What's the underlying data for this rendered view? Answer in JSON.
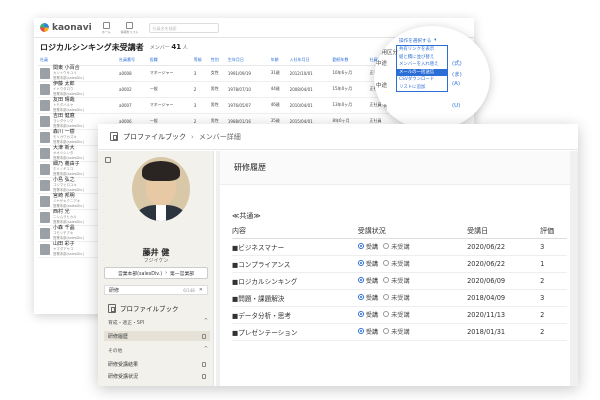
{
  "back": {
    "logo": "kaonavi",
    "nav": [
      "ホーム",
      "情報をリスト"
    ],
    "search_placeholder": "社員名を検索",
    "title": "ロジカルシンキング未受講者",
    "member_label": "メンバー",
    "member_count": "41",
    "member_unit": "人",
    "columns": [
      "社員",
      "社員番号",
      "役職",
      "等級",
      "性別",
      "生年月日",
      "年齢",
      "入社年月日",
      "勤続年数",
      "社員区分",
      "前年度",
      "評価"
    ],
    "rows": [
      {
        "name": "関東 小百合",
        "kana": "カントウサユリ",
        "dept": "営業本部(salesDiv.)",
        "no": "a0008",
        "pos": "マネージャー",
        "grade": "3",
        "sex": "女性",
        "birth": "1991/09/19",
        "age": "31歳",
        "join": "2012/10/01",
        "tenure": "10年6ヶ月",
        "cat": "正社員",
        "prev": "4年6ヶ月",
        "eval": "S"
      },
      {
        "name": "伊藤 太郎",
        "kana": "イトウタロウ",
        "dept": "営業本部(salesDiv.)",
        "no": "a0002",
        "pos": "一般",
        "grade": "2",
        "sex": "男性",
        "birth": "1978/07/10",
        "age": "44歳",
        "join": "2008/04/01",
        "tenure": "15年0ヶ月",
        "cat": "正社員",
        "prev": "5年0ヶ月",
        "eval": "A"
      },
      {
        "name": "友田 晴哉",
        "kana": "トモダハルヤ",
        "dept": "営業本部(salesDiv.)",
        "no": "a0007",
        "pos": "マネージャー",
        "grade": "3",
        "sex": "男性",
        "birth": "1976/05/07",
        "age": "46歳",
        "join": "2010/04/01",
        "tenure": "13年0ヶ月",
        "cat": "正社員",
        "prev": "3年0ヶ月",
        "eval": "B"
      },
      {
        "name": "吉田 健麿",
        "kana": "ヨシダケンマ",
        "dept": "営業本部(salesDiv.)",
        "no": "a0006",
        "pos": "一般",
        "grade": "2",
        "sex": "男性",
        "birth": "1988/01/16",
        "age": "35歳",
        "join": "2015/04/01",
        "tenure": "8年0ヶ月",
        "cat": "正社員",
        "prev": "4年0ヶ月",
        "eval": "A"
      },
      {
        "name": "森川 一樹",
        "kana": "モリカワカズキ",
        "dept": "営業本部(salesDiv.)",
        "no": "a001",
        "pos": "",
        "grade": "",
        "sex": "",
        "birth": "",
        "age": "",
        "join": "",
        "tenure": "",
        "cat": "",
        "prev": "",
        "eval": ""
      },
      {
        "name": "大津 新大",
        "kana": "オオツシンタ",
        "dept": "営業本部(salesDiv.)",
        "no": "a001",
        "pos": "",
        "grade": "",
        "sex": "",
        "birth": "",
        "age": "",
        "join": "",
        "tenure": "",
        "cat": "",
        "prev": "",
        "eval": ""
      },
      {
        "name": "細乃 義由子",
        "kana": "ホソノギユコ",
        "dept": "営業本部(salesDiv.)",
        "no": "a001",
        "pos": "",
        "grade": "",
        "sex": "",
        "birth": "",
        "age": "",
        "join": "",
        "tenure": "",
        "cat": "",
        "prev": "",
        "eval": ""
      },
      {
        "name": "小島 弘之",
        "kana": "コジマヒロユキ",
        "dept": "営業本部(salesDiv.)",
        "no": "a002",
        "pos": "",
        "grade": "",
        "sex": "",
        "birth": "",
        "age": "",
        "join": "",
        "tenure": "",
        "cat": "",
        "prev": "",
        "eval": ""
      },
      {
        "name": "宮崎 邦明",
        "kana": "ミヤザキクニアキ",
        "dept": "営業本部(salesDiv.)",
        "no": "a003",
        "pos": "",
        "grade": "",
        "sex": "",
        "birth": "",
        "age": "",
        "join": "",
        "tenure": "",
        "cat": "",
        "prev": "",
        "eval": ""
      },
      {
        "name": "西村 光",
        "kana": "ニシムラヒカル",
        "dept": "営業本部(salesDiv.)",
        "no": "a003",
        "pos": "",
        "grade": "",
        "sex": "",
        "birth": "",
        "age": "",
        "join": "",
        "tenure": "",
        "cat": "",
        "prev": "",
        "eval": ""
      },
      {
        "name": "小森 千晶",
        "kana": "コモリチアキ",
        "dept": "営業本部(salesDiv.)",
        "no": "a002",
        "pos": "",
        "grade": "",
        "sex": "",
        "birth": "",
        "age": "",
        "join": "",
        "tenure": "",
        "cat": "",
        "prev": "",
        "eval": ""
      },
      {
        "name": "山田 彩子",
        "kana": "ヤマダアヤコ",
        "dept": "営業本部(salesDiv.)",
        "no": "a007",
        "pos": "",
        "grade": "",
        "sex": "",
        "birth": "",
        "age": "",
        "join": "",
        "tenure": "",
        "cat": "",
        "prev": "",
        "eval": ""
      }
    ]
  },
  "magnifier": {
    "button_label": "操作を選択する",
    "menu": [
      "共有リンクを表示",
      "組と積に並び替え",
      "メンバーを入れ替え",
      "メールの一括送信",
      "CSVダウンロード",
      "リストに追加"
    ],
    "selected_index": 3,
    "left_col": [
      "採用区分",
      "中途",
      "",
      "中途",
      "",
      "中途"
    ],
    "right_col": [
      "",
      "(式)",
      "(ま)",
      "(A)",
      "",
      "(U)"
    ]
  },
  "front": {
    "breadcrumb": {
      "title": "プロファイルブック",
      "sub": "メンバー詳細"
    },
    "profile": {
      "name": "藤井 健",
      "kana": "フジイケン",
      "dept": "営業本部(salesDiv.)",
      "team": "第一営業部"
    },
    "search": {
      "value": "研修",
      "count": "6/148"
    },
    "sidebar": {
      "heading": "プロファイルブック",
      "sections": [
        {
          "title": "育成・適正・SPI",
          "items": [
            "研修履歴"
          ]
        },
        {
          "title": "その他",
          "items": [
            "研修受講結果",
            "研修受講状況"
          ]
        }
      ]
    },
    "panel": {
      "title": "研修履歴",
      "group": "≪共通≫",
      "headers": [
        "内容",
        "受講状況",
        "受講日",
        "評価"
      ],
      "radio_on": "受講",
      "radio_off": "未受講",
      "rows": [
        {
          "content": "■ビジネスマナー",
          "date": "2020/06/22",
          "eval": "3"
        },
        {
          "content": "■コンプライアンス",
          "date": "2020/06/22",
          "eval": "1"
        },
        {
          "content": "■ロジカルシンキング",
          "date": "2020/06/09",
          "eval": "2"
        },
        {
          "content": "■問題・課題解決",
          "date": "2018/04/09",
          "eval": "3"
        },
        {
          "content": "■データ分析・思考",
          "date": "2020/11/13",
          "eval": "2"
        },
        {
          "content": "■プレゼンテーション",
          "date": "2018/01/31",
          "eval": "2"
        }
      ]
    }
  }
}
